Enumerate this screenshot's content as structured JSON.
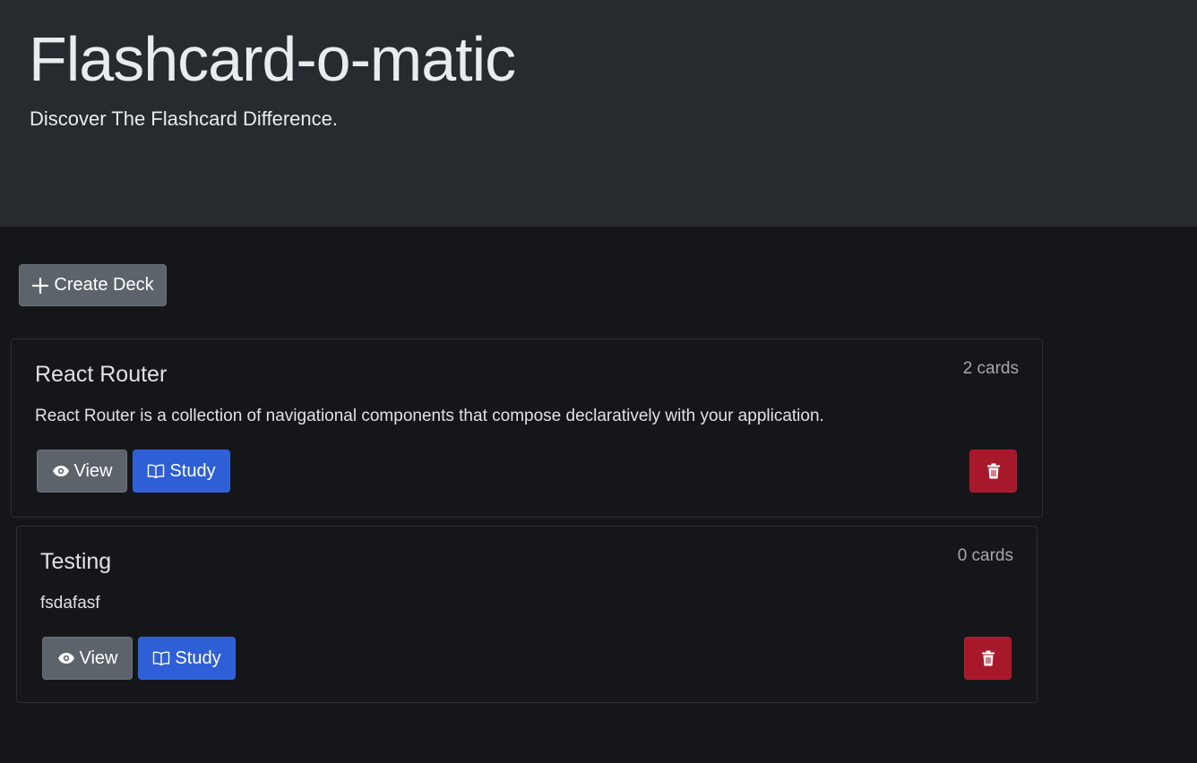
{
  "header": {
    "title": "Flashcard-o-matic",
    "tagline": "Discover The Flashcard Difference."
  },
  "toolbar": {
    "create_deck_label": "Create Deck",
    "create_icon": "plus-icon"
  },
  "decks": [
    {
      "name": "React Router",
      "card_count": "2 cards",
      "description": "React Router is a collection of navigational components that compose declaratively with your application.",
      "view_label": "View",
      "study_label": "Study"
    },
    {
      "name": "Testing",
      "card_count": "0 cards",
      "description": "fsdafasf",
      "view_label": "View",
      "study_label": "Study"
    }
  ],
  "icons": {
    "view": "eye-icon",
    "study": "book-icon",
    "delete": "trash-icon"
  },
  "colors": {
    "header_bg": "#272a2e",
    "page_bg": "#151619",
    "secondary": "#5c636a",
    "primary": "#2f5fd6",
    "danger": "#a8182b"
  }
}
